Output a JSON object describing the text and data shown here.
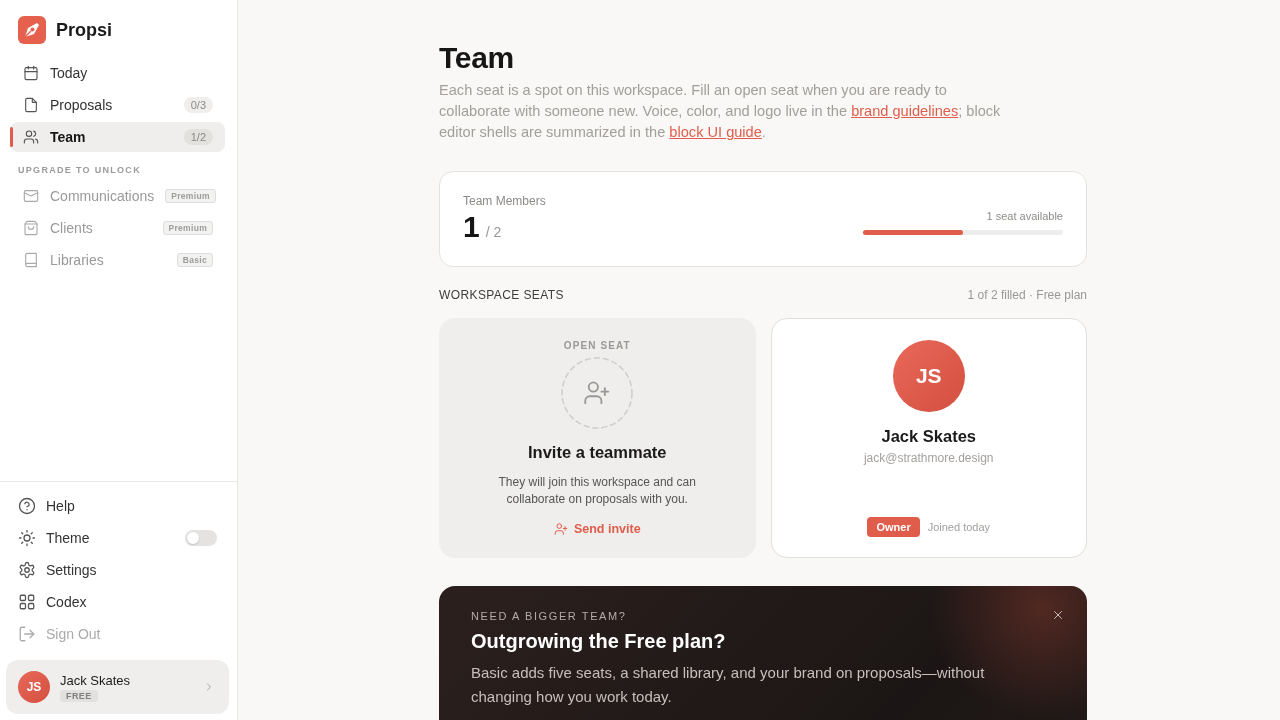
{
  "sidebar": {
    "brand": "Propsi",
    "nav_items": [
      {
        "label": "Today",
        "selected": false
      },
      {
        "label": "Proposals",
        "count": "0/3",
        "selected": false
      },
      {
        "label": "Team",
        "count": "1/2",
        "selected": true
      }
    ],
    "locked_heading": "UPGRADE TO UNLOCK",
    "locked_items": [
      {
        "label": "Communications",
        "tier": "Premium"
      },
      {
        "label": "Clients",
        "tier": "Premium"
      },
      {
        "label": "Libraries",
        "tier": "Basic"
      }
    ],
    "footer_items": [
      {
        "label": "Help",
        "kind": "link",
        "disabled": false
      },
      {
        "label": "Theme",
        "kind": "toggle",
        "on": false,
        "disabled": false
      },
      {
        "label": "Settings",
        "kind": "link",
        "disabled": false
      },
      {
        "label": "Codex",
        "kind": "link",
        "disabled": false
      },
      {
        "label": "Sign Out",
        "kind": "link",
        "disabled": true
      }
    ],
    "user": {
      "initials": "JS",
      "name": "Jack Skates",
      "plan": "FREE"
    }
  },
  "page": {
    "title": "Team",
    "description": [
      {
        "kind": "text",
        "text": "Each seat is a spot on this workspace. Fill an open seat when you are ready to collaborate with someone new. Voice, color, and logo live in the "
      },
      {
        "kind": "link",
        "text": "brand guidelines"
      },
      {
        "kind": "text",
        "text": "; block editor shells are summarized in the "
      },
      {
        "kind": "link",
        "text": "block UI guide"
      },
      {
        "kind": "text",
        "text": "."
      }
    ],
    "stats": {
      "label": "Team Members",
      "count": "1",
      "total": "/ 2",
      "availability": "1 seat available",
      "level": 0.5
    },
    "seats_heading": "WORKSPACE SEATS",
    "seats_summary": "1 of 2 filled · Free plan",
    "seats": [
      {
        "kind": "open",
        "label": "OPEN SEAT",
        "title": "Invite a teammate",
        "text": "They will join this workspace and can collaborate on proposals with you.",
        "action": "Send invite"
      },
      {
        "kind": "member",
        "initials": "JS",
        "name": "Jack Skates",
        "email": "jack@strathmore.design",
        "role": "Owner",
        "joined": "Joined today"
      }
    ],
    "promo": {
      "eyebrow": "NEED A BIGGER TEAM?",
      "title": "Outgrowing the Free plan?",
      "text": "Basic adds five seats, a shared library, and your brand on proposals—without changing how you work today."
    }
  }
}
